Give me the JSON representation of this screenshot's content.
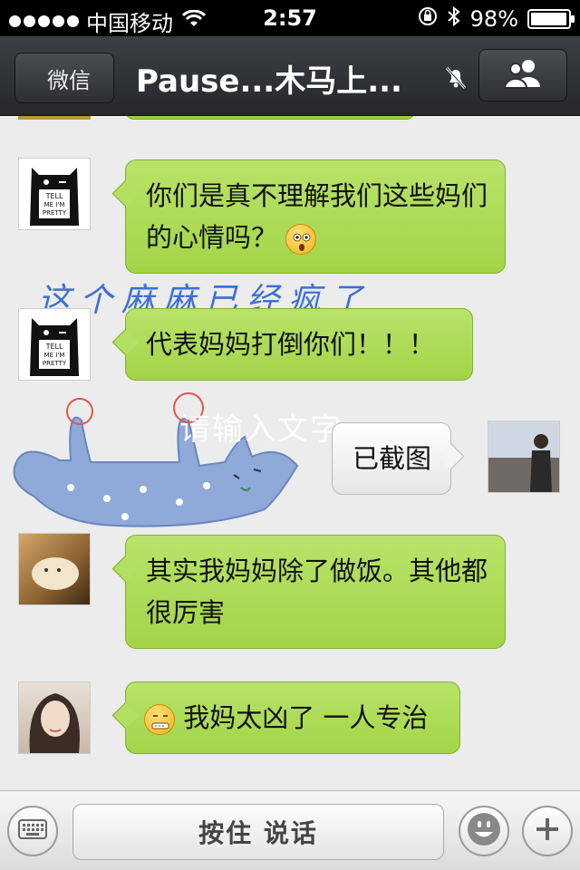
{
  "status_bar": {
    "carrier": "中国移动",
    "time": "2:57",
    "battery": "98%",
    "battery_level": 0.98
  },
  "nav": {
    "back_label": "微信",
    "title": "Pause...木马上..."
  },
  "overlays": {
    "handwriting": "这个麻麻已经疯了",
    "input_hint": "请输入文字"
  },
  "messages": [
    {
      "text": "你们是真不理解我们这些妈们的心情吗？",
      "emoji": "fearful-face-emoji"
    },
    {
      "text": "代表妈妈打倒你们！！！"
    },
    {
      "text": "已截图"
    },
    {
      "text": "其实我妈妈除了做饭。其他都很厉害"
    },
    {
      "text": "我妈太凶了 一人专治",
      "emoji": "zipper-mouth-emoji"
    }
  ],
  "monster_text": {
    "line1": "TELL",
    "line2": "ME I'M",
    "line3": "PRETTY"
  },
  "input": {
    "hold_to_talk": "按住 说话"
  },
  "colors": {
    "bubble_green": "#a2d447",
    "navbar": "#2d2f33",
    "handwriting": "#3e6fd8",
    "cat": "#8fa9d9"
  }
}
